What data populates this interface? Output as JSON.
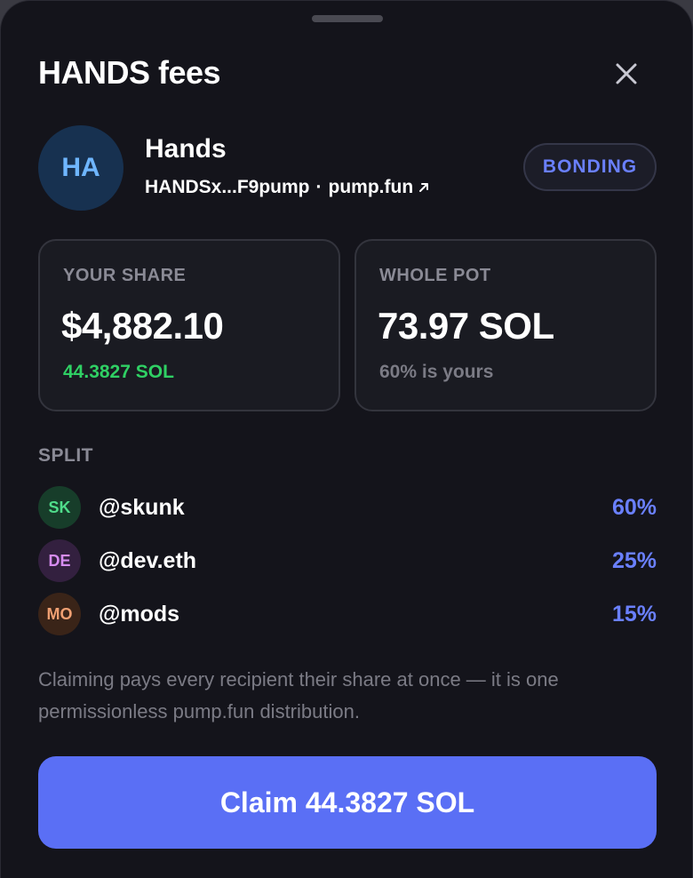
{
  "header": {
    "title": "HANDS fees",
    "close_icon": "close-icon"
  },
  "token": {
    "avatar_initials": "HA",
    "name": "Hands",
    "address": "HANDSx...F9pump",
    "separator": "·",
    "platform": "pump.fun",
    "link_icon": "external-link-icon",
    "status_badge": "BONDING"
  },
  "cards": {
    "your_share": {
      "label": "YOUR SHARE",
      "value": "$4,882.10",
      "sub": "44.3827 SOL"
    },
    "whole_pot": {
      "label": "WHOLE POT",
      "value": "73.97 SOL",
      "sub": "60% is yours"
    }
  },
  "split": {
    "label": "SPLIT",
    "recipients": [
      {
        "initials": "SK",
        "handle": "@skunk",
        "percent": "60%",
        "avatar_bg": "#173d2a",
        "avatar_fg": "#4fdc8a"
      },
      {
        "initials": "DE",
        "handle": "@dev.eth",
        "percent": "25%",
        "avatar_bg": "#33203f",
        "avatar_fg": "#d68cf0"
      },
      {
        "initials": "MO",
        "handle": "@mods",
        "percent": "15%",
        "avatar_bg": "#3a2418",
        "avatar_fg": "#f0a072"
      }
    ]
  },
  "note": "Claiming pays every recipient their share at once — it is one permissionless pump.fun distribution.",
  "claim_button": "Claim 44.3827 SOL",
  "colors": {
    "accent": "#5a6ff5",
    "badge_text": "#6a80ff",
    "positive": "#2fd064",
    "background": "#14141b"
  }
}
